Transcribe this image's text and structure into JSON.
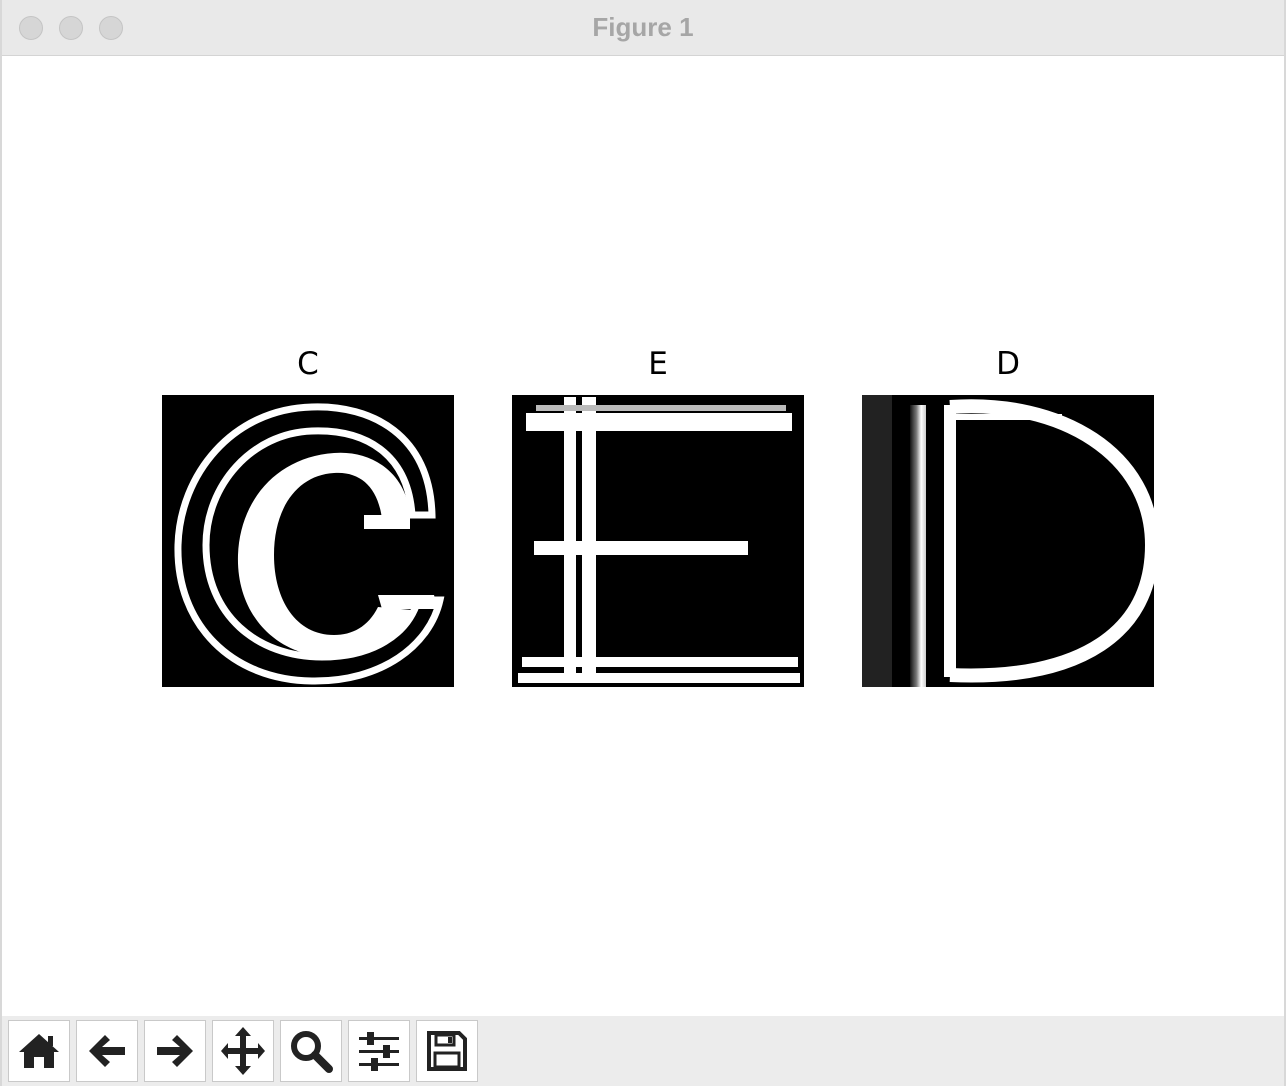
{
  "window": {
    "title": "Figure 1"
  },
  "figure": {
    "panels": [
      {
        "title": "C"
      },
      {
        "title": "E"
      },
      {
        "title": "D"
      }
    ]
  },
  "toolbar": {
    "buttons": [
      {
        "name": "home",
        "icon": "home-icon"
      },
      {
        "name": "back",
        "icon": "arrow-left-icon"
      },
      {
        "name": "forward",
        "icon": "arrow-right-icon"
      },
      {
        "name": "pan",
        "icon": "move-icon"
      },
      {
        "name": "zoom",
        "icon": "magnifier-icon"
      },
      {
        "name": "configure-subplots",
        "icon": "sliders-icon"
      },
      {
        "name": "save",
        "icon": "floppy-disk-icon"
      }
    ]
  },
  "colors": {
    "titlebar": "#e9e9e9",
    "title_text": "#a6a6a6",
    "toolbar": "#ececec",
    "image_background": "#000000",
    "glyph_stroke": "#ffffff"
  }
}
